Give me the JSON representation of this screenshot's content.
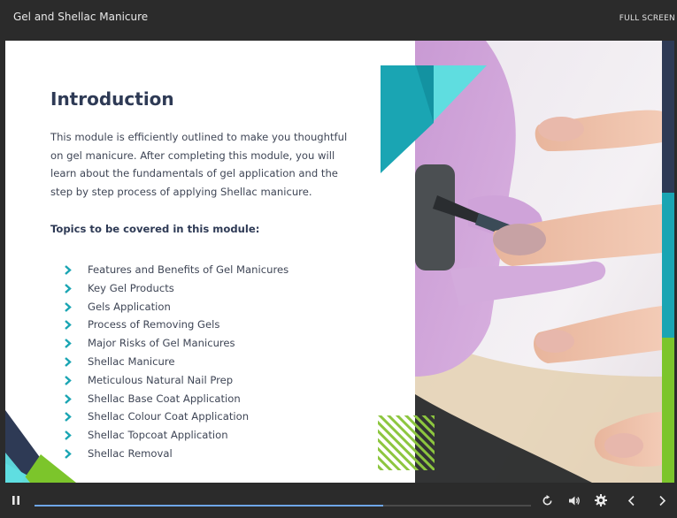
{
  "window": {
    "course_title": "Gel and Shellac Manicure",
    "fullscreen_label": "FULL SCREEN"
  },
  "slide": {
    "heading": "Introduction",
    "intro": "This module is efficiently outlined to make you thoughtful on gel manicure. After completing this module, you will learn about the fundamentals of gel application and the step by step process of applying Shellac manicure.",
    "topics_title": "Topics to be covered in this module:",
    "topics": [
      "Features and Benefits of Gel Manicures",
      "Key Gel Products",
      "Gels Application",
      "Process of Removing Gels",
      "Major Risks of Gel Manicures",
      "Shellac Manicure",
      "Meticulous Natural Nail Prep",
      "Shellac Base Coat Application",
      "Shellac Colour Coat Application",
      "Shellac Topcoat Application",
      "Shellac Removal"
    ],
    "image_icon": "nail-polish-photo"
  },
  "player": {
    "progress_fraction": 0.702,
    "icons": [
      "pause-icon",
      "replay-icon",
      "volume-icon",
      "gear-icon",
      "chevron-left-icon",
      "chevron-right-icon"
    ]
  },
  "colors": {
    "accent_teal": "#1aa5b3",
    "accent_green": "#7cc52b",
    "navy": "#2e3a55",
    "cyan_light": "#5fdde0",
    "progress": "#6ea6e8"
  }
}
